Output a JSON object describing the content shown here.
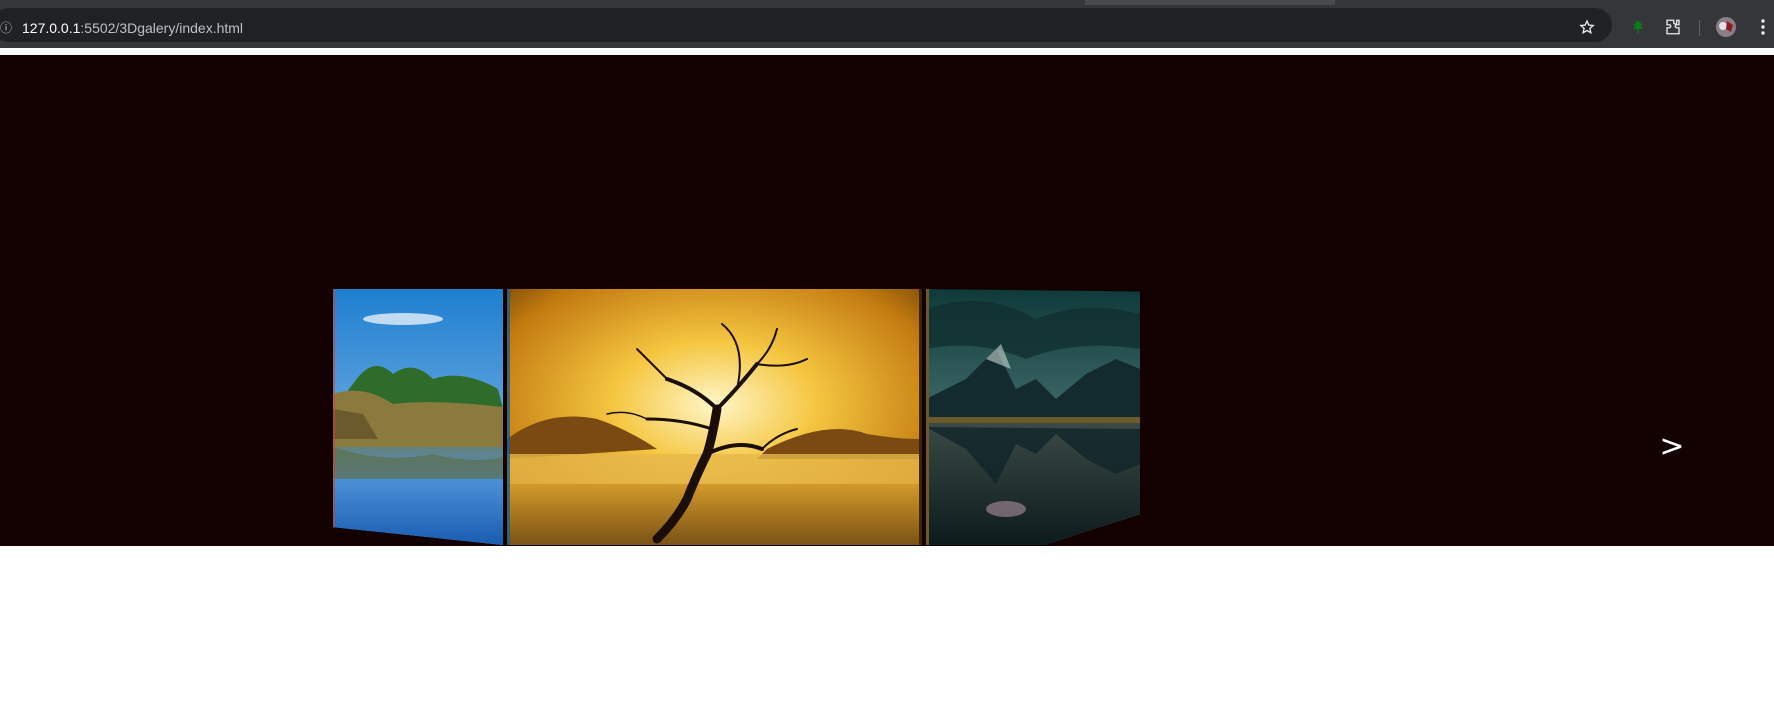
{
  "browser": {
    "url_host": "127.0.0.1",
    "url_path": ":5502/3Dgalery/index.html",
    "icons": [
      "site-info-icon",
      "bookmark-star-icon",
      "extension-leaf-icon",
      "extensions-puzzle-icon",
      "profile-avatar-icon",
      "chrome-menu-icon"
    ]
  },
  "gallery": {
    "images": [
      {
        "name": "lakeside-reeds-landscape"
      },
      {
        "name": "golden-sunset-tree"
      },
      {
        "name": "mountain-lake-reflection"
      }
    ],
    "next_label": ">"
  },
  "colors": {
    "stage_background": "#130000",
    "toolbar": "#35363a",
    "omnibox": "#202124"
  }
}
